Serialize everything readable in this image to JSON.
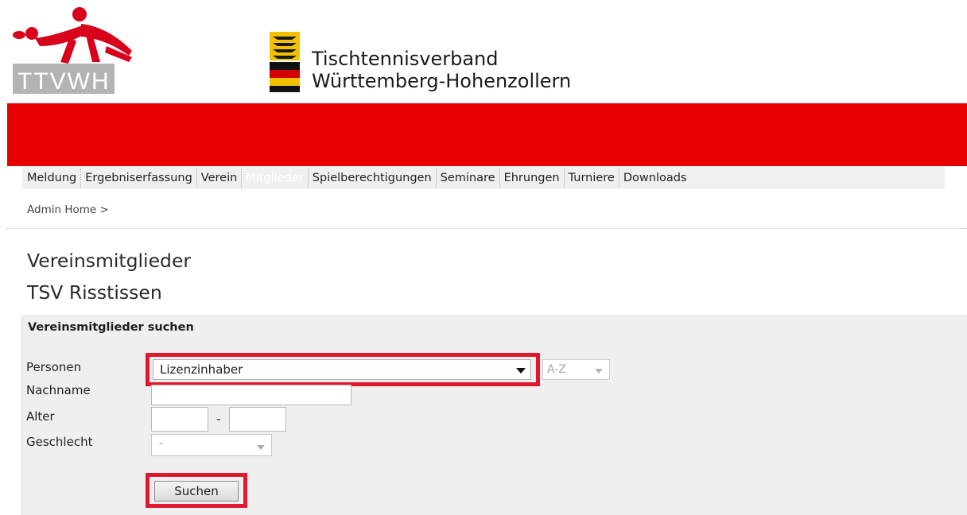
{
  "logo_left": {
    "text": "TTVWH"
  },
  "org": {
    "line1": "Tischtennisverband",
    "line2": "Württemberg-Hohenzollern"
  },
  "nav": {
    "items": [
      {
        "label": "Meldung"
      },
      {
        "label": "Ergebniserfassung"
      },
      {
        "label": "Verein"
      },
      {
        "label": "Mitglieder",
        "active": true
      },
      {
        "label": "Spielberechtigungen"
      },
      {
        "label": "Seminare"
      },
      {
        "label": "Ehrungen"
      },
      {
        "label": "Turniere"
      },
      {
        "label": "Downloads"
      }
    ]
  },
  "breadcrumb": {
    "text": "Admin Home >"
  },
  "page": {
    "title": "Vereinsmitglieder",
    "club": "TSV Risstissen"
  },
  "search": {
    "panel_title": "Vereinsmitglieder suchen",
    "labels": {
      "personen": "Personen",
      "nachname": "Nachname",
      "alter": "Alter",
      "geschlecht": "Geschlecht"
    },
    "personen_value": "Lizenzinhaber",
    "sort_value": "A-Z",
    "nachname_value": "",
    "alter_separator": "-",
    "alter_from_value": "",
    "alter_to_value": "",
    "geschlecht_value": "-",
    "button_label": "Suchen"
  },
  "colors": {
    "brand_red": "#e60000",
    "highlight_red": "#e0182d",
    "panel_bg": "#efefef",
    "nav_bg": "#f0f0f0"
  }
}
